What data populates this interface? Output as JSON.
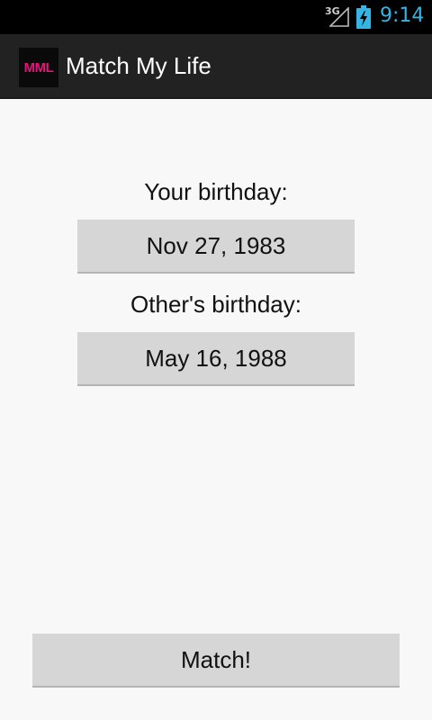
{
  "status_bar": {
    "network_type": "3G",
    "time": "9:14",
    "signal_icon": "signal-icon",
    "battery_icon": "battery-charging-icon"
  },
  "action_bar": {
    "app_icon_text": "MML",
    "app_title": "Match My Life"
  },
  "main": {
    "your_birthday_label": "Your birthday:",
    "your_birthday_value": "Nov 27, 1983",
    "other_birthday_label": "Other's birthday:",
    "other_birthday_value": "May 16, 1988",
    "match_button_label": "Match!"
  },
  "colors": {
    "accent": "#33b5e5",
    "brand": "#e8147a",
    "action_bar_bg": "#222222",
    "button_bg": "#d6d6d6"
  }
}
